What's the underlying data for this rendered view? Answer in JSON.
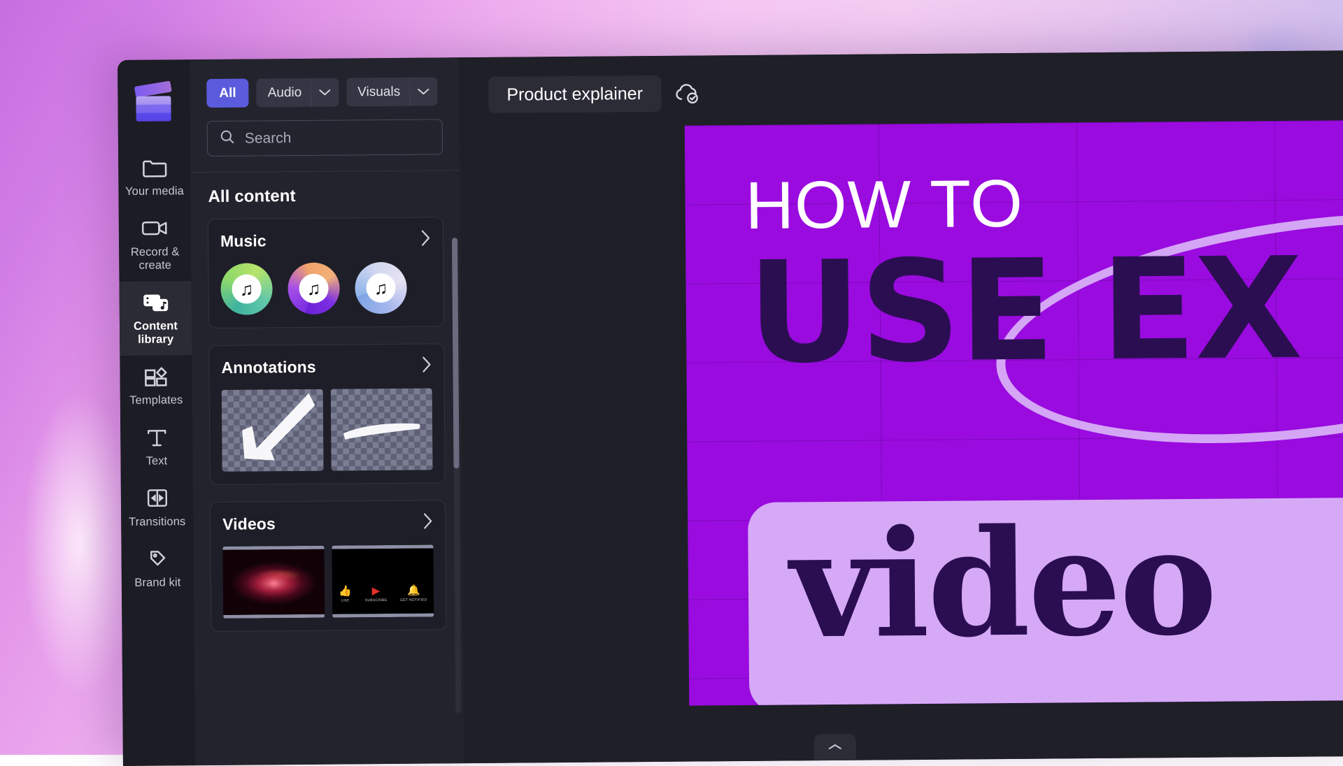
{
  "background": {
    "gradient_from": "#c66ee0",
    "gradient_mid": "#f5c7f3",
    "gradient_to": "#a8b5ee"
  },
  "theme": {
    "app_bg": "#1f1f27",
    "rail_bg": "#1c1c24",
    "panel_bg": "#23232d",
    "card_bg": "#1e1e28",
    "accent": "#5b5bdd",
    "stage_purple": "#9a0bdf",
    "stage_ink": "#2b0e52",
    "stage_lilac": "#d6a9f7"
  },
  "rail": {
    "logo_name": "clapperboard-logo",
    "items": [
      {
        "id": "your-media",
        "label": "Your media",
        "icon": "folder-icon",
        "active": false
      },
      {
        "id": "record-create",
        "label": "Record &\ncreate",
        "icon": "video-camera-icon",
        "active": false
      },
      {
        "id": "content-library",
        "label": "Content\nlibrary",
        "icon": "content-library-icon",
        "active": true
      },
      {
        "id": "templates",
        "label": "Templates",
        "icon": "templates-icon",
        "active": false
      },
      {
        "id": "text",
        "label": "Text",
        "icon": "text-icon",
        "active": false
      },
      {
        "id": "transitions",
        "label": "Transitions",
        "icon": "transitions-icon",
        "active": false
      },
      {
        "id": "brand-kit",
        "label": "Brand kit",
        "icon": "brand-kit-icon",
        "active": false
      }
    ]
  },
  "panel": {
    "filters": [
      {
        "id": "all",
        "label": "All",
        "selected": true,
        "has_caret": false
      },
      {
        "id": "audio",
        "label": "Audio",
        "selected": false,
        "has_caret": true
      },
      {
        "id": "visuals",
        "label": "Visuals",
        "selected": false,
        "has_caret": true
      }
    ],
    "search": {
      "placeholder": "Search",
      "value": "",
      "icon": "search-icon"
    },
    "heading": "All content",
    "sections": [
      {
        "id": "music",
        "title": "Music",
        "chevron": "chevron-right-icon",
        "kind": "discs",
        "items": [
          {
            "name": "music-disc-green",
            "icon": "music-note-icon"
          },
          {
            "name": "music-disc-purple",
            "icon": "music-note-icon"
          },
          {
            "name": "music-disc-blue",
            "icon": "music-note-icon"
          }
        ]
      },
      {
        "id": "annotations",
        "title": "Annotations",
        "chevron": "chevron-right-icon",
        "kind": "transparent-thumbs",
        "items": [
          {
            "name": "annotation-arrow-thumbnail"
          },
          {
            "name": "annotation-brush-stroke-thumbnail"
          }
        ]
      },
      {
        "id": "videos",
        "title": "Videos",
        "chevron": "chevron-right-icon",
        "kind": "video-thumbs",
        "items": [
          {
            "name": "video-particle-burst-thumbnail"
          },
          {
            "name": "video-youtube-buttons-thumbnail",
            "overlay": [
              {
                "icon": "thumbs-up-icon",
                "label": "LIKE"
              },
              {
                "icon": "youtube-play-icon",
                "label": "SUBSCRIBE"
              },
              {
                "icon": "bell-icon",
                "label": "GET NOTIFIED"
              }
            ]
          }
        ]
      }
    ]
  },
  "main": {
    "project_name": "Product explainer",
    "save_status_icon": "cloud-saved-icon",
    "collapse_icon": "chevron-collapse-icon"
  },
  "stage": {
    "headline": "HOW TO",
    "title": "USE EX",
    "lower_word": "video"
  }
}
